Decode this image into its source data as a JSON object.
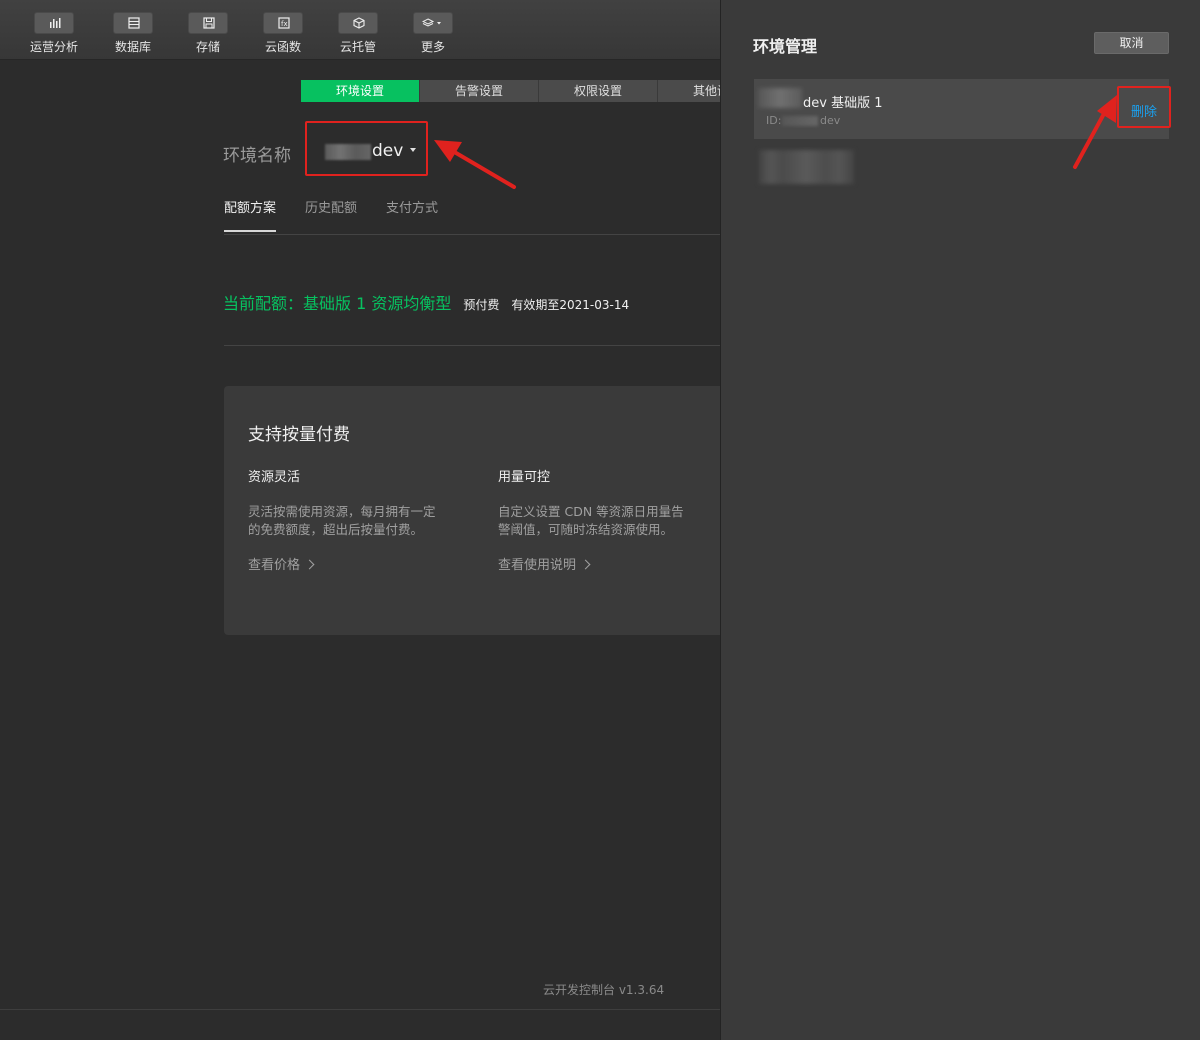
{
  "toolbar": {
    "items": [
      {
        "label": "运营分析",
        "icon": "bar-chart-icon"
      },
      {
        "label": "数据库",
        "icon": "database-icon"
      },
      {
        "label": "存储",
        "icon": "save-icon"
      },
      {
        "label": "云函数",
        "icon": "function-icon"
      },
      {
        "label": "云托管",
        "icon": "cube-icon"
      },
      {
        "label": "更多",
        "icon": "layers-icon"
      }
    ]
  },
  "tabs": [
    "环境设置",
    "告警设置",
    "权限设置",
    "其他设置"
  ],
  "env": {
    "label": "环境名称",
    "value": "dev"
  },
  "subtabs": [
    "配额方案",
    "历史配额",
    "支付方式"
  ],
  "quota": {
    "main": "当前配额：基础版 1 资源均衡型",
    "pay": "预付费",
    "expiry": "有效期至2021-03-14"
  },
  "card": {
    "title": "支持按量付费",
    "features": [
      {
        "title": "资源灵活",
        "desc_line1": "灵活按需使用资源，每月拥有一定",
        "desc_line2": "的免费额度，超出后按量付费。",
        "link": "查看价格"
      },
      {
        "title": "用量可控",
        "desc_line1": "自定义设置 CDN 等资源日用量告",
        "desc_line2": "警阈值，可随时冻结资源使用。",
        "link": "查看使用说明"
      }
    ]
  },
  "footer": {
    "version": "云开发控制台 v1.3.64"
  },
  "drawer": {
    "title": "环境管理",
    "cancel": "取消",
    "item": {
      "name": "dev 基础版 1",
      "id_label": "ID:",
      "id_value": "dev",
      "delete": "删除"
    }
  },
  "colors": {
    "accent_green": "#07c160",
    "annotation_red": "#e0221e",
    "link_blue": "#1aa1f0"
  }
}
